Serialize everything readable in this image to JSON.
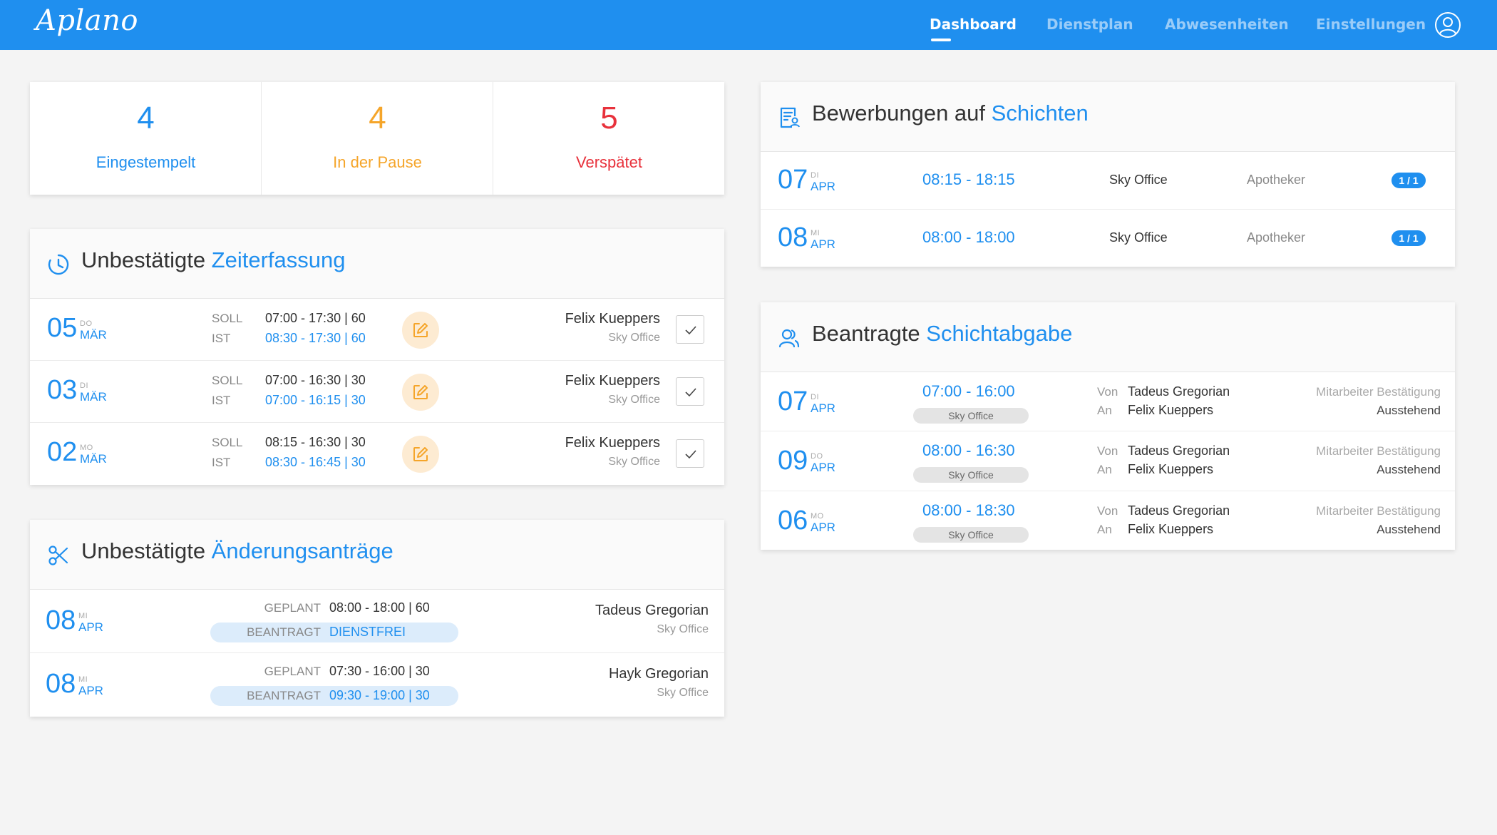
{
  "app": {
    "logo": "Aplano"
  },
  "nav": {
    "items": [
      {
        "label": "Dashboard"
      },
      {
        "label": "Dienstplan"
      },
      {
        "label": "Abwesenheiten"
      },
      {
        "label": "Einstellungen"
      }
    ]
  },
  "colors": {
    "primary": "#1f8fef",
    "orange": "#f5a52a",
    "red": "#e8323c"
  },
  "stats": [
    {
      "value": "4",
      "label": "Eingestempelt"
    },
    {
      "value": "4",
      "label": "In der Pause"
    },
    {
      "value": "5",
      "label": "Verspätet"
    }
  ],
  "zeiterfassung": {
    "title_a": "Unbestätigte ",
    "title_b": "Zeiterfassung",
    "soll_label": "SOLL",
    "ist_label": "IST",
    "rows": [
      {
        "day": "05",
        "weekday": "DO",
        "month": "MÄR",
        "soll": "07:00 - 17:30 | 60",
        "ist": "08:30 - 17:30 | 60",
        "name": "Felix Kueppers",
        "location": "Sky Office"
      },
      {
        "day": "03",
        "weekday": "DI",
        "month": "MÄR",
        "soll": "07:00 - 16:30 | 30",
        "ist": "07:00 - 16:15 | 30",
        "name": "Felix Kueppers",
        "location": "Sky Office"
      },
      {
        "day": "02",
        "weekday": "MO",
        "month": "MÄR",
        "soll": "08:15 - 16:30 | 30",
        "ist": "08:30 - 16:45 | 30",
        "name": "Felix Kueppers",
        "location": "Sky Office"
      }
    ]
  },
  "aenderungen": {
    "title_a": "Unbestätigte ",
    "title_b": "Änderungsanträge",
    "geplant_label": "GEPLANT",
    "beantragt_label": "BEANTRAGT",
    "rows": [
      {
        "day": "08",
        "weekday": "MI",
        "month": "APR",
        "geplant": "08:00 - 18:00 | 60",
        "beantragt": "DIENSTFREI",
        "name": "Tadeus Gregorian",
        "location": "Sky Office"
      },
      {
        "day": "08",
        "weekday": "MI",
        "month": "APR",
        "geplant": "07:30 - 16:00 | 30",
        "beantragt": "09:30 - 19:00 | 30",
        "name": "Hayk Gregorian",
        "location": "Sky Office"
      }
    ]
  },
  "bewerbungen": {
    "title_a": "Bewerbungen auf ",
    "title_b": "Schichten",
    "rows": [
      {
        "day": "07",
        "weekday": "DI",
        "month": "APR",
        "time": "08:15 - 18:15",
        "location": "Sky Office",
        "role": "Apotheker",
        "badge": "1 / 1"
      },
      {
        "day": "08",
        "weekday": "MI",
        "month": "APR",
        "time": "08:00 - 18:00",
        "location": "Sky Office",
        "role": "Apotheker",
        "badge": "1 / 1"
      }
    ]
  },
  "schichtabgabe": {
    "title_a": "Beantragte ",
    "title_b": "Schichtabgabe",
    "von_label": "Von",
    "an_label": "An",
    "rows": [
      {
        "day": "07",
        "weekday": "DI",
        "month": "APR",
        "time": "07:00 - 16:00",
        "location": "Sky Office",
        "von": "Tadeus Gregorian",
        "an": "Felix Kueppers",
        "status_label": "Mitarbeiter Bestätigung",
        "status": "Ausstehend"
      },
      {
        "day": "09",
        "weekday": "DO",
        "month": "APR",
        "time": "08:00 - 16:30",
        "location": "Sky Office",
        "von": "Tadeus Gregorian",
        "an": "Felix Kueppers",
        "status_label": "Mitarbeiter Bestätigung",
        "status": "Ausstehend"
      },
      {
        "day": "06",
        "weekday": "MO",
        "month": "APR",
        "time": "08:00 - 18:30",
        "location": "Sky Office",
        "von": "Tadeus Gregorian",
        "an": "Felix Kueppers",
        "status_label": "Mitarbeiter Bestätigung",
        "status": "Ausstehend"
      }
    ]
  }
}
